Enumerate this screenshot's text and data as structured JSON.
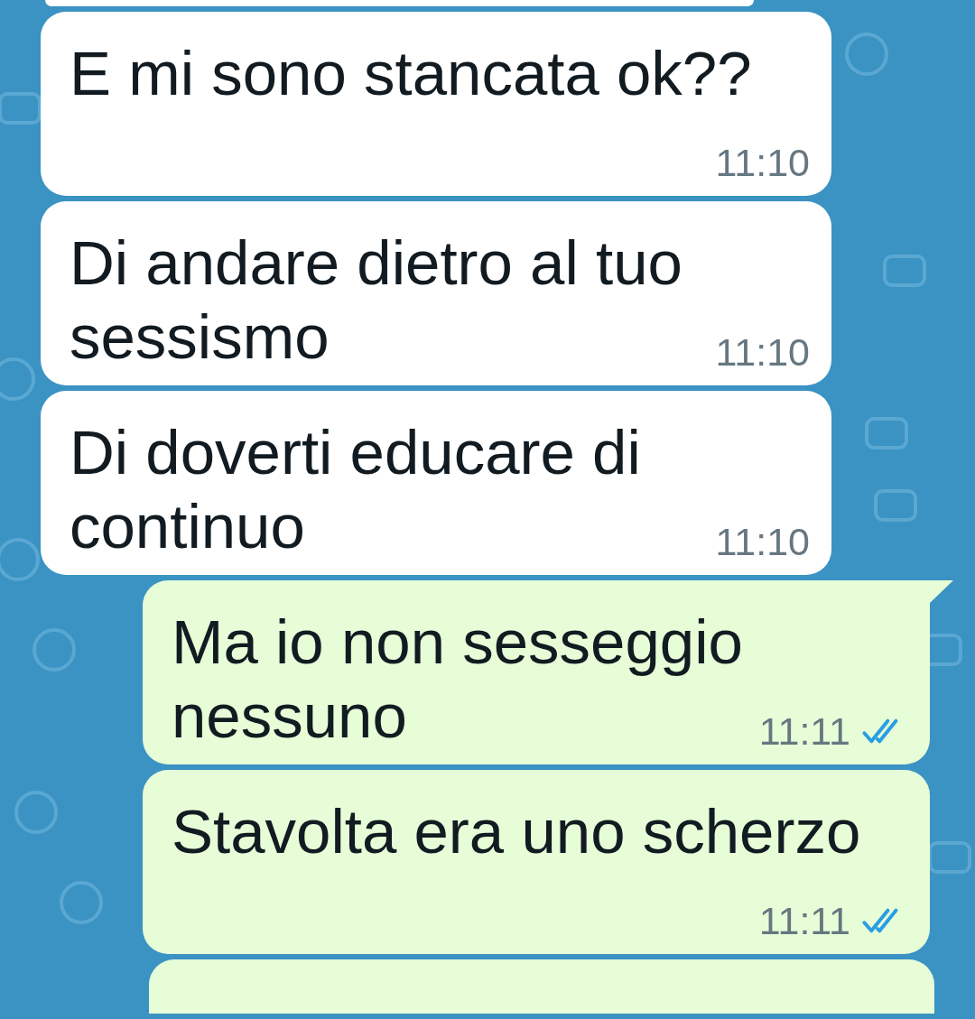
{
  "messages": [
    {
      "kind": "partial-incoming"
    },
    {
      "kind": "incoming",
      "text": "E mi sono stancata ok??",
      "time": "11:10",
      "tail": false
    },
    {
      "kind": "incoming",
      "text": "Di andare dietro al tuo sessismo",
      "time": "11:10",
      "tail": false
    },
    {
      "kind": "incoming",
      "text": "Di doverti educare di continuo",
      "time": "11:10",
      "tail": false
    },
    {
      "kind": "outgoing",
      "text": "Ma io non sesseggio nessuno",
      "time": "11:11",
      "tail": true,
      "read": true
    },
    {
      "kind": "outgoing",
      "text": "Stavolta era uno scherzo",
      "time": "11:11",
      "tail": false,
      "read": true
    },
    {
      "kind": "partial-outgoing"
    }
  ]
}
